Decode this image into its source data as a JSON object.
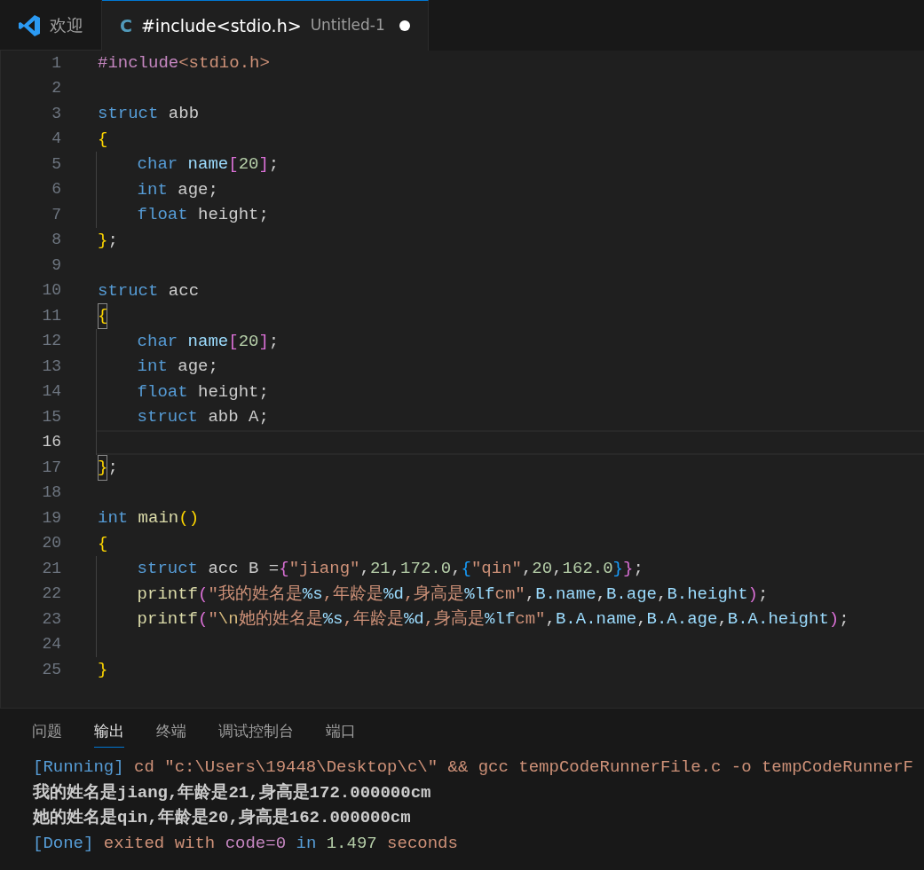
{
  "tabs": [
    {
      "kind": "welcome",
      "label": "欢迎",
      "selected": false
    },
    {
      "kind": "file",
      "icon_letter": "C",
      "label": "#include<stdio.h>",
      "description": "Untitled-1",
      "modified": true,
      "selected": true
    }
  ],
  "editor": {
    "lines": [
      {
        "number": "1",
        "current": false,
        "indent_guide": false,
        "tokens": [
          {
            "text": "#include",
            "kind": "pre"
          },
          {
            "text": "<stdio.h>",
            "kind": "str"
          }
        ]
      },
      {
        "number": "2",
        "current": false,
        "indent_guide": false
      },
      {
        "number": "3",
        "current": false,
        "indent_guide": false,
        "tokens": [
          {
            "text": "struct",
            "kind": "kw"
          },
          {
            "text": " abb",
            "kind": "pl"
          }
        ]
      },
      {
        "number": "4",
        "current": false,
        "indent_guide": false,
        "tokens": [
          {
            "text": "{",
            "kind": "b1"
          }
        ]
      },
      {
        "number": "5",
        "current": false,
        "indent_guide": true,
        "tokens": [
          {
            "text": "    char",
            "kind": "kw"
          },
          {
            "text": " name",
            "kind": "var"
          },
          {
            "text": "[",
            "kind": "b2"
          },
          {
            "text": "20",
            "kind": "num"
          },
          {
            "text": "]",
            "kind": "b2"
          },
          {
            "text": ";",
            "kind": "pl"
          }
        ]
      },
      {
        "number": "6",
        "current": false,
        "indent_guide": true,
        "tokens": [
          {
            "text": "    int",
            "kind": "kw"
          },
          {
            "text": " age;",
            "kind": "pl"
          }
        ]
      },
      {
        "number": "7",
        "current": false,
        "indent_guide": true,
        "tokens": [
          {
            "text": "    float",
            "kind": "kw"
          },
          {
            "text": " height;",
            "kind": "pl"
          }
        ]
      },
      {
        "number": "8",
        "current": false,
        "indent_guide": false,
        "tokens": [
          {
            "text": "}",
            "kind": "b1"
          },
          {
            "text": ";",
            "kind": "pl"
          }
        ]
      },
      {
        "number": "9",
        "current": false,
        "indent_guide": false
      },
      {
        "number": "10",
        "current": false,
        "indent_guide": false,
        "tokens": [
          {
            "text": "struct",
            "kind": "kw"
          },
          {
            "text": " acc",
            "kind": "pl"
          }
        ]
      },
      {
        "number": "11",
        "current": false,
        "indent_guide": false,
        "tokens": [
          {
            "text": "{",
            "kind": "b1",
            "matched": true
          }
        ]
      },
      {
        "number": "12",
        "current": false,
        "indent_guide": true,
        "tokens": [
          {
            "text": "    char",
            "kind": "kw"
          },
          {
            "text": " name",
            "kind": "var"
          },
          {
            "text": "[",
            "kind": "b2"
          },
          {
            "text": "20",
            "kind": "num"
          },
          {
            "text": "]",
            "kind": "b2"
          },
          {
            "text": ";",
            "kind": "pl"
          }
        ]
      },
      {
        "number": "13",
        "current": false,
        "indent_guide": true,
        "tokens": [
          {
            "text": "    int",
            "kind": "kw"
          },
          {
            "text": " age;",
            "kind": "pl"
          }
        ]
      },
      {
        "number": "14",
        "current": false,
        "indent_guide": true,
        "tokens": [
          {
            "text": "    float",
            "kind": "kw"
          },
          {
            "text": " height;",
            "kind": "pl"
          }
        ]
      },
      {
        "number": "15",
        "current": false,
        "indent_guide": true,
        "tokens": [
          {
            "text": "    struct",
            "kind": "kw"
          },
          {
            "text": " abb A;",
            "kind": "pl"
          }
        ]
      },
      {
        "number": "16",
        "current": true,
        "indent_guide": true
      },
      {
        "number": "17",
        "current": false,
        "indent_guide": false,
        "tokens": [
          {
            "text": "}",
            "kind": "b1",
            "matched": true
          },
          {
            "text": ";",
            "kind": "pl"
          }
        ]
      },
      {
        "number": "18",
        "current": false,
        "indent_guide": false
      },
      {
        "number": "19",
        "current": false,
        "indent_guide": false,
        "tokens": [
          {
            "text": "int",
            "kind": "kw"
          },
          {
            "text": " main",
            "kind": "fn"
          },
          {
            "text": "()",
            "kind": "b1"
          }
        ]
      },
      {
        "number": "20",
        "current": false,
        "indent_guide": false,
        "tokens": [
          {
            "text": "{",
            "kind": "b1"
          }
        ]
      },
      {
        "number": "21",
        "current": false,
        "indent_guide": true,
        "tokens": [
          {
            "text": "    struct",
            "kind": "kw"
          },
          {
            "text": " acc B =",
            "kind": "pl"
          },
          {
            "text": "{",
            "kind": "b2"
          },
          {
            "text": "\"jiang\"",
            "kind": "str"
          },
          {
            "text": ",",
            "kind": "pl"
          },
          {
            "text": "21",
            "kind": "num"
          },
          {
            "text": ",",
            "kind": "pl"
          },
          {
            "text": "172.0",
            "kind": "num"
          },
          {
            "text": ",",
            "kind": "pl"
          },
          {
            "text": "{",
            "kind": "b3"
          },
          {
            "text": "\"qin\"",
            "kind": "str"
          },
          {
            "text": ",",
            "kind": "pl"
          },
          {
            "text": "20",
            "kind": "num"
          },
          {
            "text": ",",
            "kind": "pl"
          },
          {
            "text": "162.0",
            "kind": "num"
          },
          {
            "text": "}",
            "kind": "b3"
          },
          {
            "text": "}",
            "kind": "b2"
          },
          {
            "text": ";",
            "kind": "pl"
          }
        ]
      },
      {
        "number": "22",
        "current": false,
        "indent_guide": true,
        "tokens": [
          {
            "text": "    printf",
            "kind": "fn"
          },
          {
            "text": "(",
            "kind": "b2"
          },
          {
            "text": "\"我的姓名是",
            "kind": "str"
          },
          {
            "text": "%s",
            "kind": "var"
          },
          {
            "text": ",年龄是",
            "kind": "str"
          },
          {
            "text": "%d",
            "kind": "var"
          },
          {
            "text": ",身高是",
            "kind": "str"
          },
          {
            "text": "%lf",
            "kind": "var"
          },
          {
            "text": "cm\"",
            "kind": "str"
          },
          {
            "text": ",",
            "kind": "pl"
          },
          {
            "text": "B.name",
            "kind": "var"
          },
          {
            "text": ",",
            "kind": "pl"
          },
          {
            "text": "B.age",
            "kind": "var"
          },
          {
            "text": ",",
            "kind": "pl"
          },
          {
            "text": "B.height",
            "kind": "var"
          },
          {
            "text": ")",
            "kind": "b2"
          },
          {
            "text": ";",
            "kind": "pl"
          }
        ]
      },
      {
        "number": "23",
        "current": false,
        "indent_guide": true,
        "tokens": [
          {
            "text": "    printf",
            "kind": "fn"
          },
          {
            "text": "(",
            "kind": "b2"
          },
          {
            "text": "\"",
            "kind": "str"
          },
          {
            "text": "\\n",
            "kind": "esc"
          },
          {
            "text": "她的姓名是",
            "kind": "str"
          },
          {
            "text": "%s",
            "kind": "var"
          },
          {
            "text": ",年龄是",
            "kind": "str"
          },
          {
            "text": "%d",
            "kind": "var"
          },
          {
            "text": ",身高是",
            "kind": "str"
          },
          {
            "text": "%lf",
            "kind": "var"
          },
          {
            "text": "cm\"",
            "kind": "str"
          },
          {
            "text": ",",
            "kind": "pl"
          },
          {
            "text": "B.A.name",
            "kind": "var"
          },
          {
            "text": ",",
            "kind": "pl"
          },
          {
            "text": "B.A.age",
            "kind": "var"
          },
          {
            "text": ",",
            "kind": "pl"
          },
          {
            "text": "B.A.height",
            "kind": "var"
          },
          {
            "text": ")",
            "kind": "b2"
          },
          {
            "text": ";",
            "kind": "pl"
          }
        ]
      },
      {
        "number": "24",
        "current": false,
        "indent_guide": true
      },
      {
        "number": "25",
        "current": false,
        "indent_guide": false,
        "tokens": [
          {
            "text": "}",
            "kind": "b1"
          }
        ]
      }
    ]
  },
  "panel": {
    "tabs": [
      {
        "label": "问题",
        "selected": false
      },
      {
        "label": "输出",
        "selected": true
      },
      {
        "label": "终端",
        "selected": false
      },
      {
        "label": "调试控制台",
        "selected": false
      },
      {
        "label": "端口",
        "selected": false
      }
    ],
    "output": [
      {
        "tokens": [
          {
            "text": "[Running]",
            "kind": "kw"
          },
          {
            "text": " cd \"c:\\Users\\19448\\Desktop\\c\\\" && gcc tempCodeRunnerFile.c -o tempCodeRunnerF",
            "kind": "str"
          }
        ]
      },
      {
        "tokens": [
          {
            "text": "我的姓名是jiang,年龄是21,身高是172.000000cm",
            "kind": "out"
          }
        ]
      },
      {
        "tokens": [
          {
            "text": "她的姓名是qin,年龄是20,身高是162.000000cm",
            "kind": "out"
          }
        ]
      },
      {
        "tokens": [
          {
            "text": "[Done]",
            "kind": "kw"
          },
          {
            "text": " exited with ",
            "kind": "str"
          },
          {
            "text": "code=0",
            "kind": "pre"
          },
          {
            "text": " in ",
            "kind": "kw"
          },
          {
            "text": "1.497",
            "kind": "num"
          },
          {
            "text": " seconds",
            "kind": "str"
          }
        ]
      }
    ]
  }
}
